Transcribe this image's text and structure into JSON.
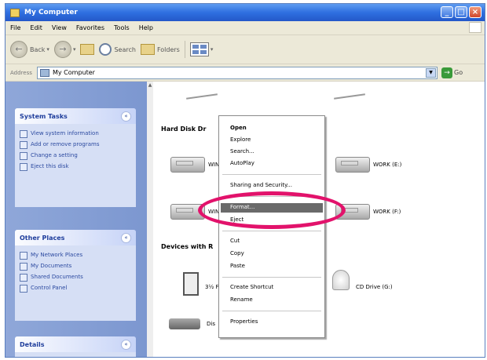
{
  "window": {
    "title": "My Computer"
  },
  "menubar": [
    "File",
    "Edit",
    "View",
    "Favorites",
    "Tools",
    "Help"
  ],
  "toolbar": {
    "back": "Back",
    "search": "Search",
    "folders": "Folders"
  },
  "address": {
    "label": "Address",
    "value": "My Computer",
    "go": "Go"
  },
  "sidebar": {
    "system_tasks": {
      "title": "System Tasks",
      "items": [
        "View system information",
        "Add or remove programs",
        "Change a setting",
        "Eject this disk"
      ]
    },
    "other_places": {
      "title": "Other Places",
      "items": [
        "My Network Places",
        "My Documents",
        "Shared Documents",
        "Control Panel"
      ]
    },
    "details": {
      "title": "Details"
    }
  },
  "content": {
    "hard_disk_header": "Hard Disk Dr",
    "devices_header": "Devices with R",
    "drives": [
      {
        "label": "WIN"
      },
      {
        "label": "WORK (E:)"
      },
      {
        "label": "WIN"
      },
      {
        "label": "WORK (F:)"
      },
      {
        "label": "3½ F"
      },
      {
        "label": "CD Drive (G:)"
      },
      {
        "label": "Dis"
      }
    ]
  },
  "context_menu": {
    "items": [
      "Open",
      "Explore",
      "Search...",
      "AutoPlay",
      "Sharing and Security...",
      "Format...",
      "Eject",
      "Cut",
      "Copy",
      "Paste",
      "Create Shortcut",
      "Rename",
      "Properties"
    ],
    "active": "Format..."
  },
  "colors": {
    "highlight_ellipse": "#e2126b",
    "title_bar": "#2f6fe0",
    "sidebar": "#7c97d0"
  }
}
